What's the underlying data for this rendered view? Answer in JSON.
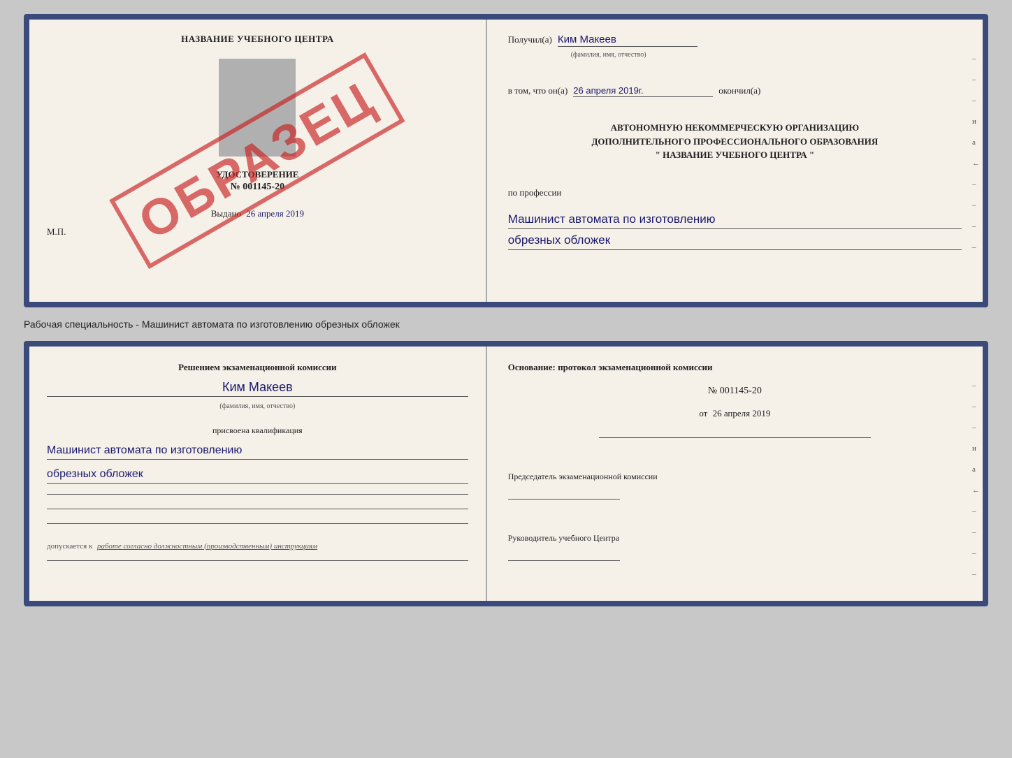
{
  "top_cert": {
    "left": {
      "school_name": "НАЗВАНИЕ УЧЕБНОГО ЦЕНТРА",
      "stamp_text": "ОБРАЗЕЦ",
      "udostoverenie_label": "УДОСТОВЕРЕНИЕ",
      "cert_number": "№ 001145-20",
      "vydano_label": "Выдано",
      "vydano_date": "26 апреля 2019",
      "mp_label": "М.П."
    },
    "right": {
      "received_label": "Получил(а)",
      "recipient_name": "Ким Макеев",
      "fio_label": "(фамилия, имя, отчество)",
      "in_that_label": "в том, что он(а)",
      "completion_date": "26 апреля 2019г.",
      "finished_label": "окончил(а)",
      "org_line1": "АВТОНОМНУЮ НЕКОММЕРЧЕСКУЮ ОРГАНИЗАЦИЮ",
      "org_line2": "ДОПОЛНИТЕЛЬНОГО ПРОФЕССИОНАЛЬНОГО ОБРАЗОВАНИЯ",
      "org_name": "\"  НАЗВАНИЕ УЧЕБНОГО ЦЕНТРА  \"",
      "profession_label": "по профессии",
      "profession_line1": "Машинист автомата по изготовлению",
      "profession_line2": "обрезных обложек",
      "side_marks": [
        "–",
        "–",
        "–",
        "и",
        "а",
        "←",
        "–",
        "–",
        "–",
        "–"
      ]
    }
  },
  "subtitle": "Рабочая специальность - Машинист автомата по изготовлению обрезных обложек",
  "bottom_cert": {
    "left": {
      "decision_text": "Решением экзаменационной комиссии",
      "name": "Ким Макеев",
      "fio_label": "(фамилия, имя, отчество)",
      "qualification_label": "присвоена квалификация",
      "qualification_line1": "Машинист автомата по изготовлению",
      "qualification_line2": "обрезных обложек",
      "допускается_prefix": "допускается к",
      "допускается_text": "работе согласно должностным (производственным) инструкциям"
    },
    "right": {
      "osnov_text": "Основание: протокол экзаменационной комиссии",
      "protocol_number": "№  001145-20",
      "date_prefix": "от",
      "protocol_date": "26 апреля 2019",
      "chairman_label": "Председатель экзаменационной комиссии",
      "head_label": "Руководитель учебного Центра",
      "side_marks": [
        "–",
        "–",
        "–",
        "и",
        "а",
        "←",
        "–",
        "–",
        "–",
        "–"
      ]
    }
  }
}
